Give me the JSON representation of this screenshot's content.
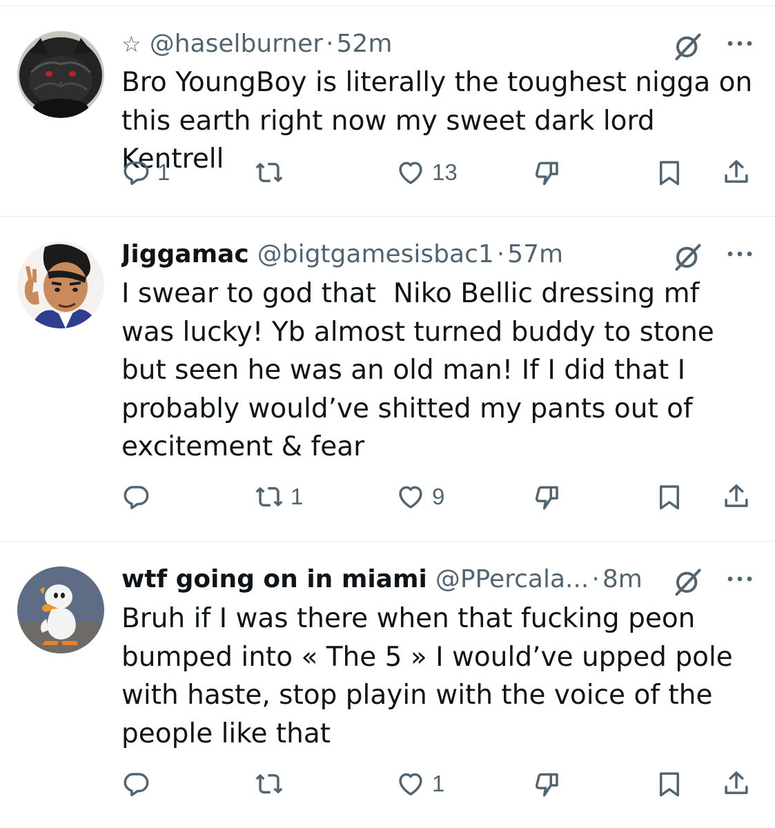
{
  "tweets": [
    {
      "star": "☆",
      "display_name": "",
      "handle": "@haselburner",
      "separator": "·",
      "time": "52m",
      "text": "Bro YoungBoy is literally the toughest nigga on this earth right now my sweet dark lord Kentrell",
      "replies": "1",
      "retweets": "",
      "likes": "13"
    },
    {
      "star": "",
      "display_name": "Jiggamac",
      "handle": "@bigtgamesisbac1",
      "separator": "·",
      "time": "57m",
      "text": "I swear to god that  Niko Bellic dressing mf was lucky! Yb almost turned buddy to stone but seen he was an old man! If I did that I probably would’ve shitted my pants out of excitement & fear",
      "replies": "",
      "retweets": "1",
      "likes": "9"
    },
    {
      "star": "",
      "display_name": "wtf going on in miami",
      "handle": "@PPercala...",
      "separator": "·",
      "time": "8m",
      "text": "Bruh if I was there when that fucking peon bumped into « The 5 » I would’ve upped pole with haste, stop playin with the voice of the people like that",
      "replies": "",
      "retweets": "",
      "likes": "1"
    }
  ],
  "colors": {
    "text": "#0f1419",
    "muted": "#536471",
    "divider": "#e6e9ec"
  },
  "icons": [
    "star-icon",
    "grok-icon",
    "more-icon",
    "reply-icon",
    "retweet-icon",
    "like-icon",
    "downvote-icon",
    "bookmark-icon",
    "share-icon"
  ]
}
